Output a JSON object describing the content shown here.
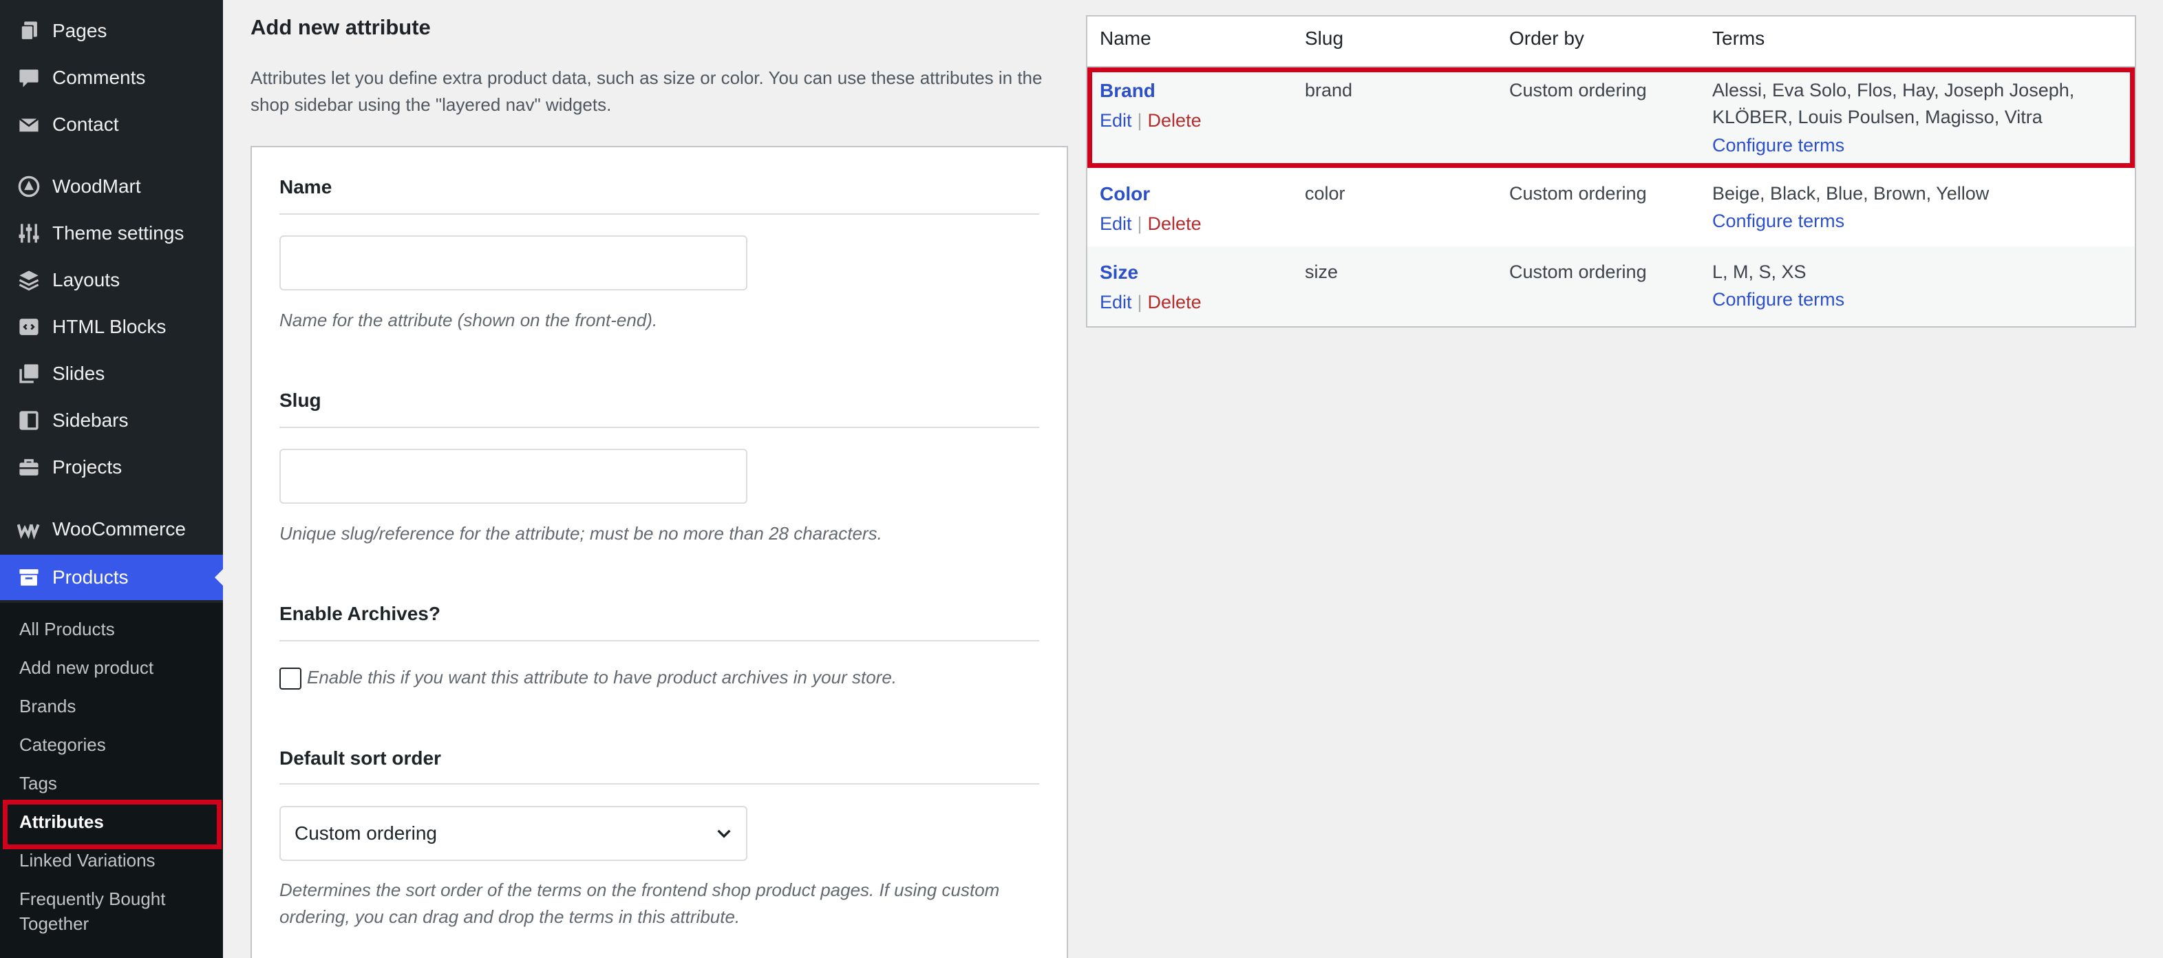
{
  "sidebar": {
    "items": [
      {
        "label": "Pages",
        "icon": "pages-icon"
      },
      {
        "label": "Comments",
        "icon": "comments-icon"
      },
      {
        "label": "Contact",
        "icon": "mail-icon"
      },
      {
        "label": "WoodMart",
        "icon": "woodmart-icon"
      },
      {
        "label": "Theme settings",
        "icon": "sliders-icon"
      },
      {
        "label": "Layouts",
        "icon": "layers-icon"
      },
      {
        "label": "HTML Blocks",
        "icon": "code-block-icon"
      },
      {
        "label": "Slides",
        "icon": "slides-icon"
      },
      {
        "label": "Sidebars",
        "icon": "sidebar-icon"
      },
      {
        "label": "Projects",
        "icon": "briefcase-icon"
      },
      {
        "label": "WooCommerce",
        "icon": "woocommerce-icon"
      },
      {
        "label": "Products",
        "icon": "archive-box-icon"
      }
    ],
    "submenu": [
      "All Products",
      "Add new product",
      "Brands",
      "Categories",
      "Tags",
      "Attributes",
      "Linked Variations",
      "Frequently Bought Together"
    ],
    "active_color": "#3858e9",
    "highlight_color": "#d0021b"
  },
  "form": {
    "title": "Add new attribute",
    "description": "Attributes let you define extra product data, such as size or color. You can use these attributes in the shop sidebar using the \"layered nav\" widgets.",
    "name_label": "Name",
    "name_value": "",
    "name_help": "Name for the attribute (shown on the front-end).",
    "slug_label": "Slug",
    "slug_value": "",
    "slug_help": "Unique slug/reference for the attribute; must be no more than 28 characters.",
    "archives_label": "Enable Archives?",
    "archives_checkbox_label": "Enable this if you want this attribute to have product archives in your store.",
    "archives_checked": false,
    "sort_label": "Default sort order",
    "sort_value": "Custom ordering",
    "sort_help": "Determines the sort order of the terms on the frontend shop product pages. If using custom ordering, you can drag and drop the terms in this attribute."
  },
  "table": {
    "headers": [
      "Name",
      "Slug",
      "Order by",
      "Terms"
    ],
    "rows": [
      {
        "name": "Brand",
        "slug": "brand",
        "order_by": "Custom ordering",
        "terms": "Alessi, Eva Solo, Flos, Hay, Joseph Joseph, KLÖBER, Louis Poulsen, Magisso, Vitra",
        "edit": "Edit",
        "delete": "Delete",
        "separator": "|",
        "configure": "Configure terms"
      },
      {
        "name": "Color",
        "slug": "color",
        "order_by": "Custom ordering",
        "terms": "Beige, Black, Blue, Brown, Yellow",
        "edit": "Edit",
        "delete": "Delete",
        "separator": "|",
        "configure": "Configure terms"
      },
      {
        "name": "Size",
        "slug": "size",
        "order_by": "Custom ordering",
        "terms": "L, M, S, XS",
        "edit": "Edit",
        "delete": "Delete",
        "separator": "|",
        "configure": "Configure terms"
      }
    ],
    "link_color": "#2c50c9",
    "delete_color": "#b32d2e"
  }
}
